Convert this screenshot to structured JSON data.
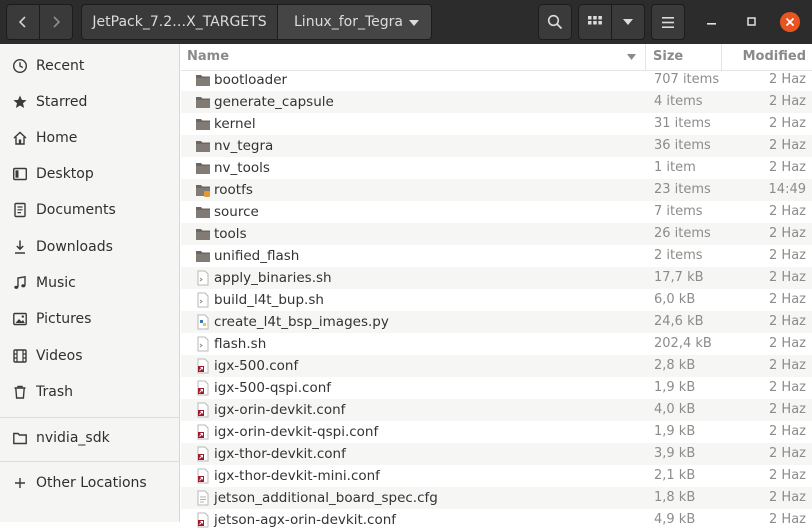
{
  "titlebar": {
    "back_icon": "chevron-left-icon",
    "forward_icon": "chevron-right-icon",
    "breadcrumb": [
      "JetPack_7.2…X_TARGETS",
      "Linux_for_Tegra"
    ],
    "breadcrumb_menu_icon": "triangle-down-icon",
    "search_icon": "search-icon",
    "view_icon": "grid-view-icon",
    "view_menu_icon": "triangle-down-icon",
    "menu_icon": "hamburger-icon",
    "minimize_icon": "minimize-icon",
    "maximize_icon": "maximize-icon",
    "close_icon": "close-icon",
    "close_color": "#e95420"
  },
  "sidebar": {
    "items": [
      {
        "label": "Recent",
        "icon": "clock-icon"
      },
      {
        "label": "Starred",
        "icon": "star-icon"
      },
      {
        "label": "Home",
        "icon": "home-icon"
      },
      {
        "label": "Desktop",
        "icon": "desktop-icon"
      },
      {
        "label": "Documents",
        "icon": "document-icon"
      },
      {
        "label": "Downloads",
        "icon": "download-icon"
      },
      {
        "label": "Music",
        "icon": "music-note-icon"
      },
      {
        "label": "Pictures",
        "icon": "picture-icon"
      },
      {
        "label": "Videos",
        "icon": "film-icon"
      },
      {
        "label": "Trash",
        "icon": "trash-icon"
      }
    ],
    "mounts": [
      {
        "label": "nvidia_sdk",
        "icon": "folder-icon"
      }
    ],
    "other": {
      "label": "Other Locations",
      "icon": "plus-icon"
    }
  },
  "columns": {
    "name": "Name",
    "size": "Size",
    "modified": "Modified",
    "sort_icon": "sort-down-icon"
  },
  "files": [
    {
      "name": "bootloader",
      "size": "707 items",
      "modified": "2 Haz",
      "type": "folder"
    },
    {
      "name": "generate_capsule",
      "size": "4 items",
      "modified": "2 Haz",
      "type": "folder"
    },
    {
      "name": "kernel",
      "size": "31 items",
      "modified": "2 Haz",
      "type": "folder"
    },
    {
      "name": "nv_tegra",
      "size": "36 items",
      "modified": "2 Haz",
      "type": "folder"
    },
    {
      "name": "nv_tools",
      "size": "1 item",
      "modified": "2 Haz",
      "type": "folder"
    },
    {
      "name": "rootfs",
      "size": "23 items",
      "modified": "14:49",
      "type": "folder-locked"
    },
    {
      "name": "source",
      "size": "7 items",
      "modified": "2 Haz",
      "type": "folder"
    },
    {
      "name": "tools",
      "size": "26 items",
      "modified": "2 Haz",
      "type": "folder"
    },
    {
      "name": "unified_flash",
      "size": "2 items",
      "modified": "2 Haz",
      "type": "folder"
    },
    {
      "name": "apply_binaries.sh",
      "size": "17,7 kB",
      "modified": "2 Haz",
      "type": "script"
    },
    {
      "name": "build_l4t_bup.sh",
      "size": "6,0 kB",
      "modified": "2 Haz",
      "type": "script"
    },
    {
      "name": "create_l4t_bsp_images.py",
      "size": "24,6 kB",
      "modified": "2 Haz",
      "type": "python"
    },
    {
      "name": "flash.sh",
      "size": "202,4 kB",
      "modified": "2 Haz",
      "type": "script"
    },
    {
      "name": "igx-500.conf",
      "size": "2,8 kB",
      "modified": "2 Haz",
      "type": "link"
    },
    {
      "name": "igx-500-qspi.conf",
      "size": "1,9 kB",
      "modified": "2 Haz",
      "type": "link"
    },
    {
      "name": "igx-orin-devkit.conf",
      "size": "4,0 kB",
      "modified": "2 Haz",
      "type": "link"
    },
    {
      "name": "igx-orin-devkit-qspi.conf",
      "size": "1,9 kB",
      "modified": "2 Haz",
      "type": "link"
    },
    {
      "name": "igx-thor-devkit.conf",
      "size": "3,9 kB",
      "modified": "2 Haz",
      "type": "link"
    },
    {
      "name": "igx-thor-devkit-mini.conf",
      "size": "2,1 kB",
      "modified": "2 Haz",
      "type": "link"
    },
    {
      "name": "jetson_additional_board_spec.cfg",
      "size": "1,8 kB",
      "modified": "2 Haz",
      "type": "text"
    },
    {
      "name": "jetson-agx-orin-devkit.conf",
      "size": "4,9 kB",
      "modified": "2 Haz",
      "type": "link"
    }
  ]
}
